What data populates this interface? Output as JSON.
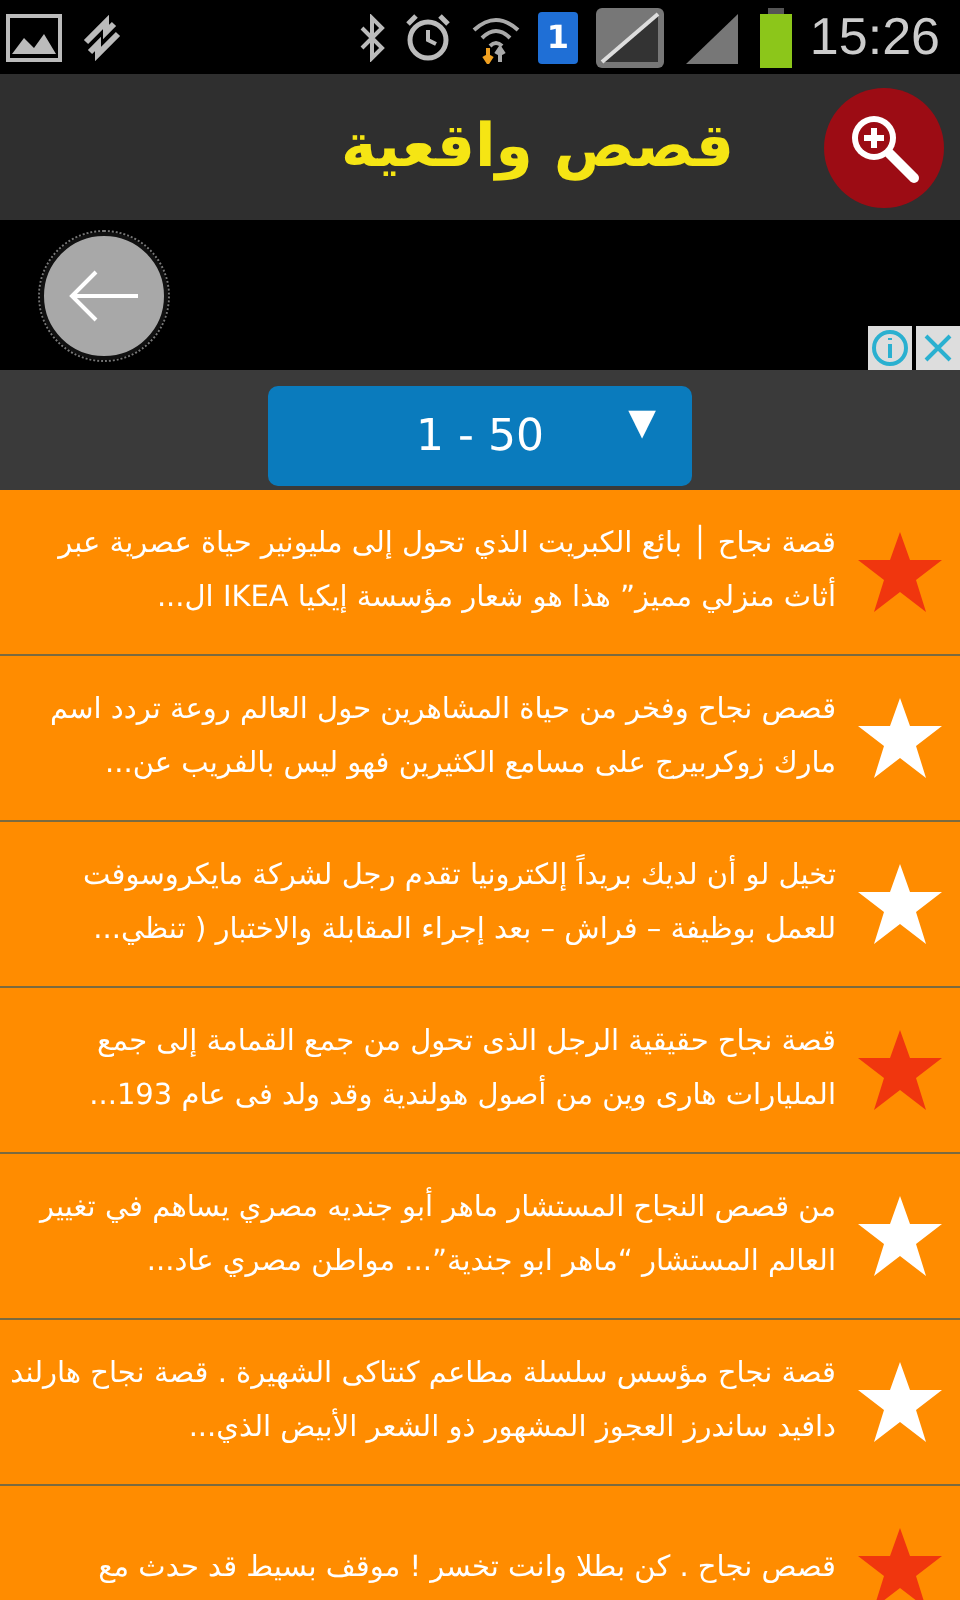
{
  "status_bar": {
    "time": "15:26",
    "sim_number": "1"
  },
  "app_bar": {
    "title": "قصص واقعية"
  },
  "range_picker": {
    "value": "1 - 50",
    "arrow": "▼"
  },
  "stories": [
    {
      "text": "قصة نجاح │ بائع الكبريت الذي تحول إلى مليونير حياة عصرية عبر أثاث منزلي مميز” هذا هو شعار مؤسسة إيكيا IKEA ال...",
      "favorite": true
    },
    {
      "text": "قصص نجاح وفخر من حياة المشاهرين حول العالم روعة تردد اسم مارك زوكربيرج على مسامع الكثيرين فهو ليس بالفريب عن...",
      "favorite": false
    },
    {
      "text": "تخيل لو أن لديك بريداً إلكترونيا تقدم رجل لشركة مايكروسوفت للعمل بوظيفة – فراش – بعد إجراء المقابلة والاختبار ( تنظي...",
      "favorite": false
    },
    {
      "text": "قصة نجاح حقيقية الرجل الذى تحول من جمع القمامة إلى جمع المليارات هارى وين من أصول هولندية وقد ولد فى عام 193...",
      "favorite": true
    },
    {
      "text": "من قصص النجاح المستشار ماهر أبو جنديه مصري يساهم في تغيير العالم المستشار “ماهر ابو جندية”... مواطن مصري عاد...",
      "favorite": false
    },
    {
      "text": "قصة نجاح مؤسس سلسلة مطاعم كنتاكى الشهيرة . قصة نجاح هارلند دافيد ساندرز العجوز المشهور ذو الشعر الأبيض الذي...",
      "favorite": false
    },
    {
      "text": "قصص نجاح . كن بطلا وانت تخسر ! موقف بسيط قد حدث مع",
      "favorite": true
    }
  ]
}
